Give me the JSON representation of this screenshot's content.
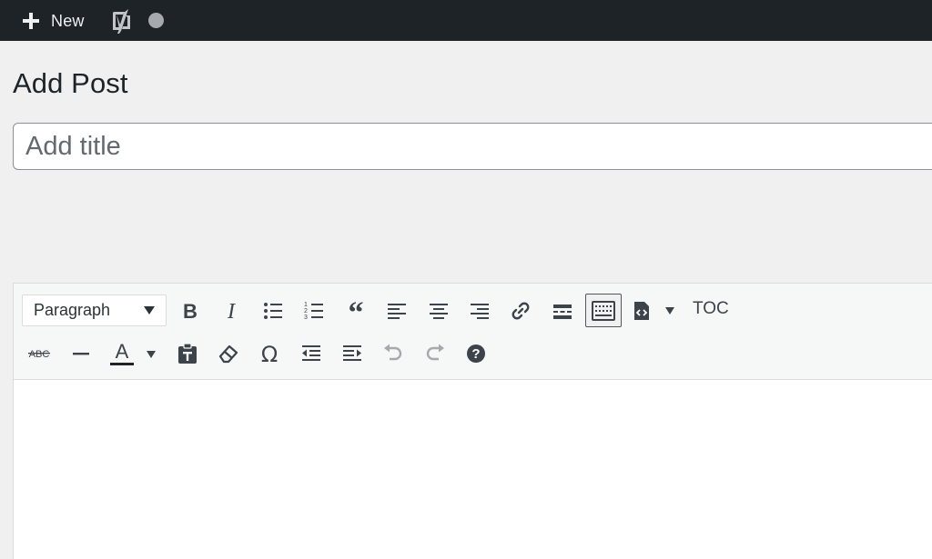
{
  "adminbar": {
    "new_label": "New"
  },
  "page": {
    "title": "Add Post"
  },
  "title_field": {
    "placeholder": "Add title",
    "value": ""
  },
  "toolbar": {
    "format_select": "Paragraph",
    "toc_label": "TOC",
    "row1": [
      "bold-icon",
      "italic-icon",
      "bulleted-list-icon",
      "numbered-list-icon",
      "blockquote-icon",
      "align-left-icon",
      "align-center-icon",
      "align-right-icon",
      "link-icon",
      "read-more-icon",
      "toolbar-toggle-icon",
      "shortcode-icon"
    ],
    "row2": [
      "strikethrough-icon",
      "horizontal-line-icon",
      "text-color-icon",
      "paste-text-icon",
      "clear-formatting-icon",
      "special-character-icon",
      "outdent-icon",
      "indent-icon",
      "undo-icon",
      "redo-icon",
      "help-icon"
    ]
  },
  "colors": {
    "adminbar_bg": "#1d2327",
    "page_bg": "#f0f0f1",
    "toolbar_bg": "#f6f7f7",
    "icon": "#3c434a",
    "icon_disabled": "#a7aaad"
  }
}
